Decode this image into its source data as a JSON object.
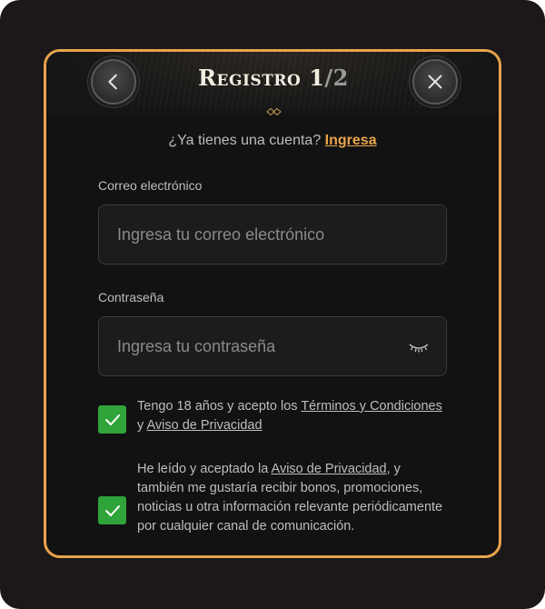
{
  "header": {
    "title": "Registro 1",
    "step_separator": "/",
    "step_total": "2",
    "back_icon": "chevron-left-icon",
    "close_icon": "close-icon"
  },
  "login_prompt": {
    "text": "¿Ya tienes una cuenta?",
    "link": "Ingresa"
  },
  "email": {
    "label": "Correo electrónico",
    "placeholder": "Ingresa tu correo electrónico",
    "value": ""
  },
  "password": {
    "label": "Contraseña",
    "placeholder": "Ingresa tu contraseña",
    "value": "",
    "toggle_icon": "eye-closed-icon"
  },
  "consents": [
    {
      "checked": true,
      "text_before": "Tengo 18 años y acepto los",
      "link1": "Términos y Condiciones",
      "conjunction": "y",
      "link2": "Aviso de Privacidad"
    },
    {
      "checked": true,
      "text_before": "He leído y aceptado la",
      "link1": "Aviso de Privacidad",
      "text_after": ", y también me gustaría recibir bonos, promociones, noticias u otra información relevante periódicamente por cualquier canal de comunicación."
    }
  ],
  "colors": {
    "accent": "#e8a44c",
    "checkbox": "#2fa43a",
    "background": "#121212"
  }
}
